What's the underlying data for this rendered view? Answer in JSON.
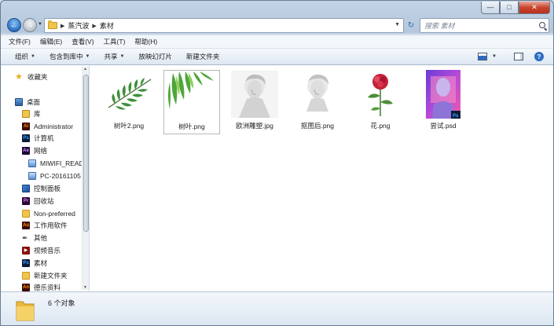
{
  "address": {
    "crumbs": [
      "蒸汽波",
      "素材"
    ]
  },
  "search": {
    "placeholder": "搜索 素材"
  },
  "menu": [
    "文件(F)",
    "编辑(E)",
    "查看(V)",
    "工具(T)",
    "帮助(H)"
  ],
  "commands": {
    "organize": "组织",
    "include": "包含到库中",
    "share": "共享",
    "slideshow": "放映幻灯片",
    "newfolder": "新建文件夹"
  },
  "nav": {
    "favorites": "收藏夹",
    "desktop": "桌面",
    "library": "库",
    "admin": "Administrator",
    "computer": "计算机",
    "network": "网络",
    "host1": "MIWIFI_READ",
    "host2": "PC-20161105",
    "control": "控制面板",
    "recycle": "回收站",
    "nonpref": "Non-preferred",
    "worksoft": "工作用软件",
    "other": "其他",
    "videomusic": "视频音乐",
    "material": "素材",
    "newfolder": "新建文件夹",
    "gamedata": "德乐资料"
  },
  "files": [
    {
      "name": "树叶2.png",
      "icon": "leaf-image-icon"
    },
    {
      "name": "树叶.png",
      "icon": "leaf-image-icon"
    },
    {
      "name": "欧洲雕塑.jpg",
      "icon": "statue-image-icon"
    },
    {
      "name": "抠图后.png",
      "icon": "statue-image-icon"
    },
    {
      "name": "花.png",
      "icon": "flower-image-icon"
    },
    {
      "name": "尝试.psd",
      "icon": "psd-file-icon"
    }
  ],
  "status": "6 个对象",
  "colors": {
    "selection_border": "#b8b8b8",
    "close_red": "#c9452e",
    "folder_yellow": "#f0c54c"
  }
}
